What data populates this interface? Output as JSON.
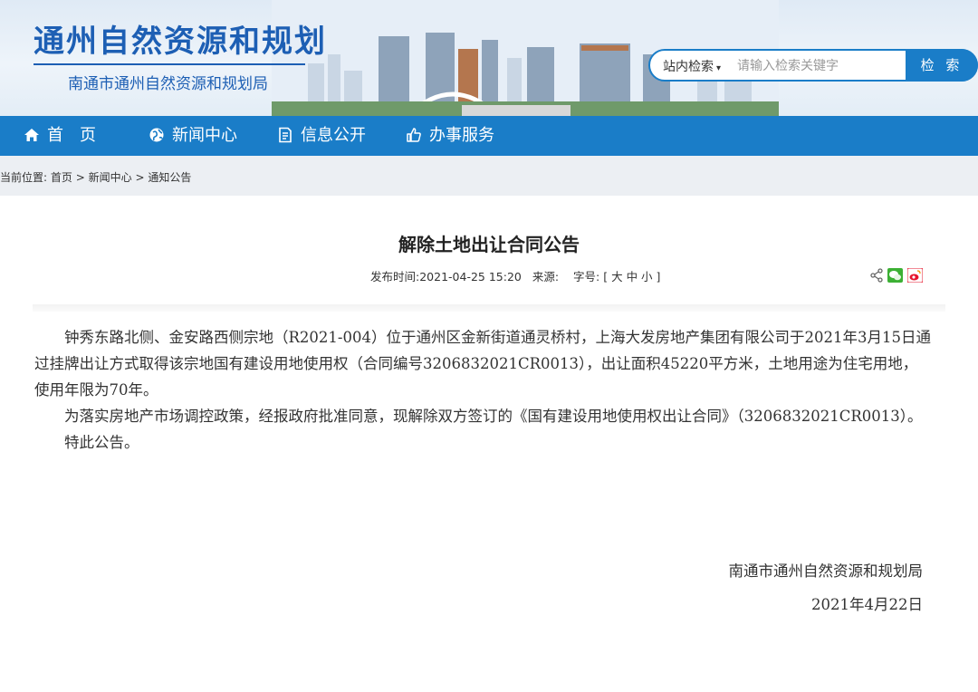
{
  "header": {
    "site_title": "通州自然资源和规划",
    "site_subtitle": "南通市通州自然资源和规划局"
  },
  "search": {
    "scope_label": "站内检索",
    "placeholder": "请输入检索关键字",
    "button_label": "检 索"
  },
  "nav": {
    "items": [
      {
        "label": "首　页",
        "icon": "home-icon"
      },
      {
        "label": "新闻中心",
        "icon": "globe-icon"
      },
      {
        "label": "信息公开",
        "icon": "document-icon"
      },
      {
        "label": "办事服务",
        "icon": "thumbs-up-icon"
      }
    ]
  },
  "breadcrumb": {
    "prefix": "当前位置:",
    "items": [
      "首页",
      "新闻中心",
      "通知公告"
    ],
    "separator": ">"
  },
  "article": {
    "title": "解除土地出让合同公告",
    "publish_label": "发布时间:",
    "publish_time": "2021-04-25 15:20",
    "source_label": "来源:",
    "font_size_label": "字号:",
    "font_size_options": "[ 大 中 小 ]",
    "paragraphs": [
      "钟秀东路北侧、金安路西侧宗地（R2021-004）位于通州区金新街道通灵桥村，上海大发房地产集团有限公司于2021年3月15日通过挂牌出让方式取得该宗地国有建设用地使用权（合同编号3206832021CR0013），出让面积45220平方米，土地用途为住宅用地，使用年限为70年。",
      "为落实房地产市场调控政策，经报政府批准同意，现解除双方签订的《国有建设用地使用权出让合同》（3206832021CR0013）。",
      "特此公告。"
    ],
    "signature_org": "南通市通州自然资源和规划局",
    "signature_date": "2021年4月22日"
  },
  "share_tools": [
    "share-icon",
    "wechat-icon",
    "weibo-icon"
  ],
  "colors": {
    "brand_blue": "#1a7dc8",
    "title_blue": "#1d5fb4",
    "breadcrumb_bg": "#eceff3"
  }
}
